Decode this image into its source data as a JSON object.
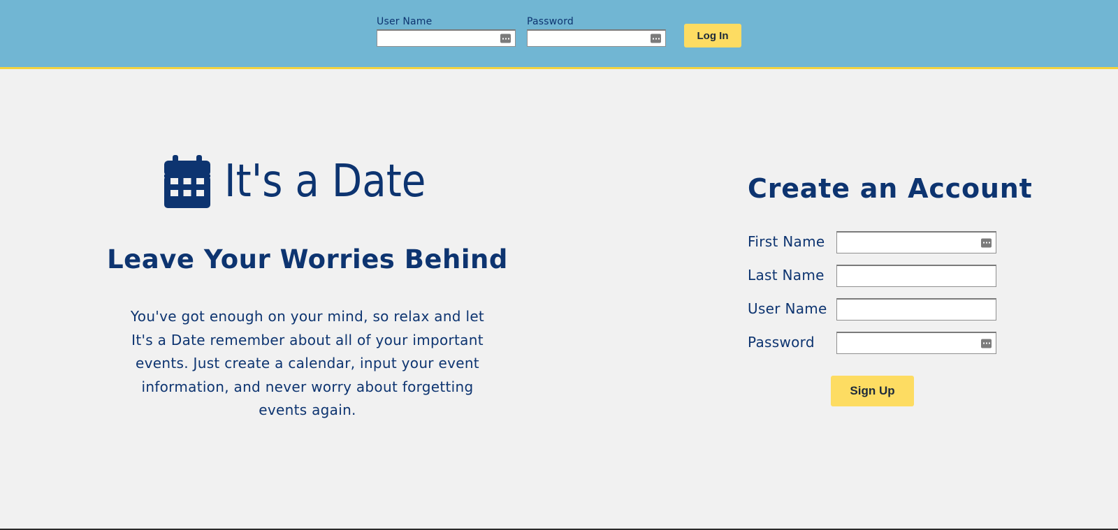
{
  "header": {
    "username_label": "User Name",
    "password_label": "Password",
    "username_value": "",
    "password_value": "",
    "login_label": "Log In"
  },
  "brand": {
    "name": "It's a Date",
    "icon": "calendar-icon"
  },
  "hero": {
    "tagline": "Leave Your Worries Behind",
    "description": "You've got enough on your mind, so relax and let It's a Date remember about all of your important events. Just create a calendar, input your event information, and never worry about forgetting events again."
  },
  "signup": {
    "title": "Create an Account",
    "fields": [
      {
        "label": "First Name",
        "value": ""
      },
      {
        "label": "Last Name",
        "value": ""
      },
      {
        "label": "User Name",
        "value": ""
      },
      {
        "label": "Password",
        "value": ""
      }
    ],
    "button_label": "Sign Up"
  },
  "colors": {
    "header_bg": "#71b6d3",
    "accent_yellow": "#fddc62",
    "header_border": "#f3d33e",
    "text_navy": "#0d3470",
    "page_bg": "#f1f1f1"
  }
}
